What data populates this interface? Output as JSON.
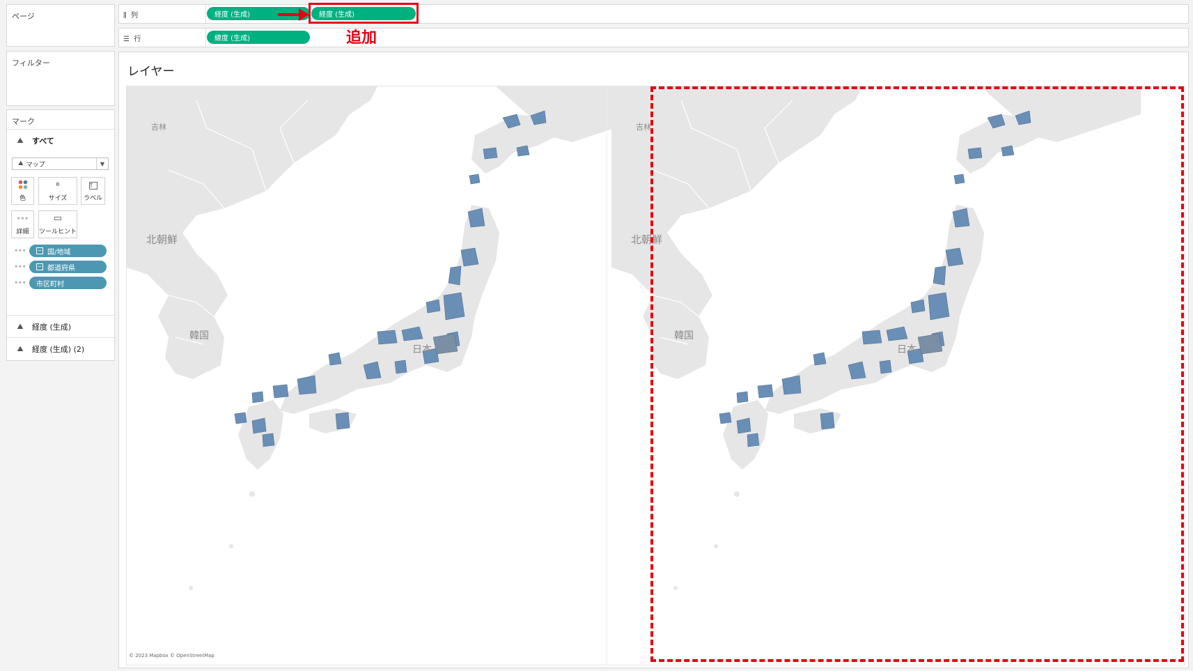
{
  "left_panel": {
    "pages_title": "ページ",
    "filters_title": "フィルター",
    "marks": {
      "title": "マーク",
      "all_label": "すべて",
      "mark_type": "マップ",
      "buttons": {
        "color": "色",
        "size": "サイズ",
        "label": "ラベル",
        "detail": "詳細",
        "tooltip": "ツールヒント"
      },
      "fields": [
        {
          "name": "国/地域"
        },
        {
          "name": "都道府県"
        },
        {
          "name": "市区町村"
        }
      ],
      "layers": [
        {
          "name": "経度 (生成)"
        },
        {
          "name": "経度 (生成) (2)"
        }
      ]
    }
  },
  "shelves": {
    "columns": {
      "label": "列",
      "pills": [
        "経度 (生成)",
        "経度 (生成)"
      ]
    },
    "rows": {
      "label": "行",
      "pills": [
        "緯度 (生成)"
      ]
    }
  },
  "annotation": {
    "add_label": "追加",
    "color": "#e60012"
  },
  "viz": {
    "title": "レイヤー",
    "attribution": "© 2023 Mapbox © OpenStreetMap",
    "map_labels": {
      "jilin": "吉林",
      "north_korea": "北朝鮮",
      "south_korea": "韓国",
      "japan": "日本"
    }
  },
  "colors": {
    "pill_green": "#00b180",
    "pill_blue": "#4c98b2",
    "region_fill": "#6a8fb7",
    "land": "#e6e6e6"
  }
}
